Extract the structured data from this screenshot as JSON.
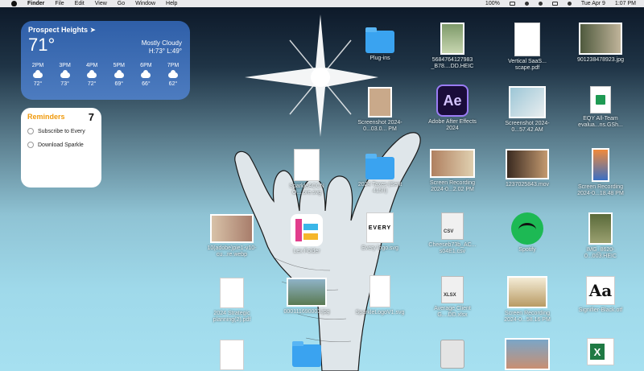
{
  "menubar": {
    "app": "Finder",
    "menus": [
      "File",
      "Edit",
      "View",
      "Go",
      "Window",
      "Help"
    ],
    "battery": "100%",
    "date": "Tue Apr 9",
    "time": "1:07 PM"
  },
  "weather": {
    "city": "Prospect Heights",
    "temp": "71°",
    "condition": "Mostly Cloudy",
    "hilo": "H:73° L:49°",
    "hours": [
      {
        "time": "2PM",
        "temp": "72°"
      },
      {
        "time": "3PM",
        "temp": "73°"
      },
      {
        "time": "4PM",
        "temp": "72°"
      },
      {
        "time": "5PM",
        "temp": "69°"
      },
      {
        "time": "6PM",
        "temp": "66°"
      },
      {
        "time": "7PM",
        "temp": "62°"
      }
    ]
  },
  "reminders": {
    "title": "Reminders",
    "count": "7",
    "items": [
      "Subscribe to Every",
      "Download Sparkle"
    ]
  },
  "icons": {
    "plugins": "Plug-ins",
    "heic1": "5684764127983 _B78....DD.HEIC",
    "vertical_saas": "Vertical SaaS... scape.pdf",
    "jpg_9012": "901238478923.jpg",
    "screenshot1": "Screenshot 2024-0...03.0... PM",
    "after_effects": "Adobe After Effects 2024",
    "screenshot2": "Screenshot 2024-0...57.42 AM",
    "eqy": "EQY All-Team evalua...ns.GSh...",
    "sparkleaccn": "SparkleACCN O....ore.svg",
    "folder2": "2024 Taxes (Sent 415!!)",
    "recording1": "Screen Recording 2024-0...2.02 PM",
    "mov_1237": "1237025843.mov",
    "recording2": "Screen Recording 2024-0...18.48 PM",
    "webp": "10(adobe)pie1-v10-cu...re.webp",
    "lex_folder": "Lex Folder",
    "every_logo": "Every logo.svg",
    "csv": "Cheeseb73b_AC... s04E1.csv",
    "spotify": "Spotify",
    "heic2": "IMG_8620-0...003.HEIC",
    "strategic": "2024 Strategic planning(2).pdf",
    "jpg_0001": "000111690003.jpg",
    "sparkle_logo": "SparkleLogoV1.svg",
    "xlsx_file": "Average Client G....DD.xlsx",
    "recording3": "Screen Recording 2024-0...58.16 PM",
    "signifier": "Signifier-Black.otf",
    "every_wordmark": "EVERY",
    "xlsx_tag": "XLSX",
    "csv_tag": "CSV",
    "ae_tag": "Ae",
    "aa_tag": "Aa"
  },
  "colors": {
    "weather_bg": "#3b6bb4",
    "reminders_accent": "#f09a0c",
    "folder": "#3aa3f0",
    "spotify": "#1db954",
    "sheets": "#1e9a53",
    "excel": "#1f7a44",
    "after_effects": "#9a7cf5"
  }
}
